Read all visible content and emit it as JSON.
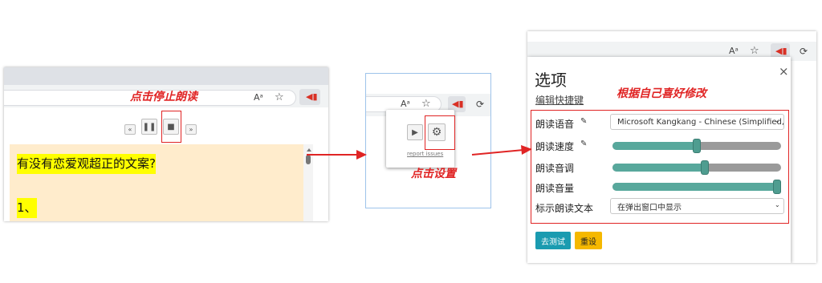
{
  "panel1": {
    "callout": "点击停止朗读",
    "omnibox_icons": {
      "read_aloud": "Aᵃ",
      "bookmark": "☆"
    },
    "controls": {
      "rewind": "«",
      "pause": "❚❚",
      "stop": "■",
      "forward": "»"
    },
    "text_lines": [
      "有没有恋爱观超正的文案?",
      "1、"
    ]
  },
  "panel2": {
    "callout": "点击设置",
    "omnibox_icons": {
      "read_aloud": "Aᵃ",
      "bookmark": "☆"
    },
    "play_symbol": "▶",
    "gear_symbol": "⚙",
    "report_link": "report issues",
    "puzzle_symbol": "⟳"
  },
  "panel3": {
    "title": "选项",
    "shortcut_link": "编辑快捷键",
    "close_symbol": "×",
    "callout": "根据自己喜好修改",
    "omnibox_icons": {
      "read_aloud": "Aᵃ",
      "bookmark": "☆"
    },
    "puzzle_symbol": "⟳",
    "rows": {
      "voice_label": "朗读语音",
      "voice_value": "Microsoft Kangkang - Chinese (Simplified, I",
      "rate_label": "朗读速度",
      "pitch_label": "朗读音调",
      "volume_label": "朗读音量",
      "highlight_label": "标示朗读文本",
      "highlight_value": "在弹出窗口中显示"
    },
    "sliders": {
      "rate": 0.5,
      "pitch": 0.55,
      "volume": 1.0
    },
    "edit_symbol": "✎",
    "test_button": "去测试",
    "reset_button": "重设"
  },
  "colors": {
    "annotation_red": "#e02424",
    "teal": "#1a9bb0",
    "yellow": "#f5b800",
    "slider_green": "#58a89c"
  }
}
